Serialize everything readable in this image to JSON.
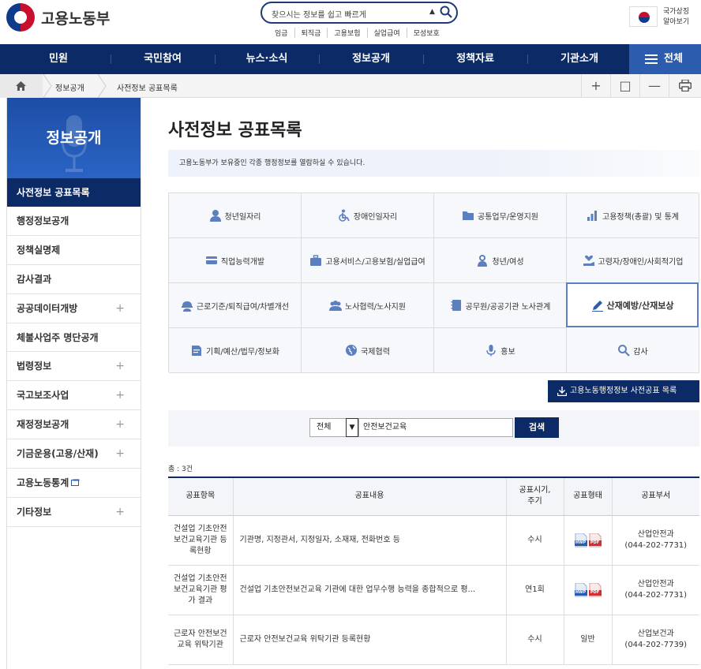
{
  "header": {
    "logo_text": "고용노동부",
    "search_placeholder": "찾으시는 정보를 쉽고 빠르게",
    "quick_links": [
      "임금",
      "퇴직금",
      "고용보험",
      "실업급여",
      "모성보호"
    ],
    "flag_text_1": "국가상징",
    "flag_text_2": "알아보기"
  },
  "gnb": {
    "items": [
      "민원",
      "국민참여",
      "뉴스·소식",
      "정보공개",
      "정책자료",
      "기관소개"
    ],
    "all_label": "전체"
  },
  "breadcrumb": {
    "items": [
      "정보공개",
      "사전정보 공표목록"
    ],
    "tools": [
      "+",
      "□",
      "—",
      "print"
    ]
  },
  "sidebar": {
    "title": "정보공개",
    "current": "사전정보 공표목록",
    "items": [
      {
        "label": "행정정보공개",
        "expand": false
      },
      {
        "label": "정책실명제",
        "expand": false
      },
      {
        "label": "감사결과",
        "expand": false
      },
      {
        "label": "공공데이터개방",
        "expand": true
      },
      {
        "label": "체불사업주 명단공개",
        "expand": false
      },
      {
        "label": "법령정보",
        "expand": true
      },
      {
        "label": "국고보조사업",
        "expand": true
      },
      {
        "label": "재정정보공개",
        "expand": true
      },
      {
        "label": "기금운용(고용/산재)",
        "expand": true
      },
      {
        "label": "고용노동통계",
        "expand": false
      },
      {
        "label": "기타정보",
        "expand": true
      }
    ]
  },
  "page": {
    "title": "사전정보 공표목록",
    "intro": "고용노동부가 보유중인 각종 행정정보를 열람하실 수 있습니다."
  },
  "categories": [
    {
      "label": "청년일자리",
      "icon": "person-icon"
    },
    {
      "label": "장애인일자리",
      "icon": "wheelchair-icon"
    },
    {
      "label": "공통업무/운영지원",
      "icon": "folder-icon"
    },
    {
      "label": "고용정책(총괄) 및 통계",
      "icon": "bar-chart-icon"
    },
    {
      "label": "직업능력개발",
      "icon": "card-icon"
    },
    {
      "label": "고용서비스/고용보험/실업급여",
      "icon": "briefcase-icon"
    },
    {
      "label": "청년/여성",
      "icon": "woman-icon"
    },
    {
      "label": "고령자/장애인/사회적기업",
      "icon": "hand-heart-icon"
    },
    {
      "label": "근로기준/퇴직급여/차별개선",
      "icon": "worker-icon"
    },
    {
      "label": "노사협력/노사지원",
      "icon": "group-icon"
    },
    {
      "label": "공무원/공공기관 노사관계",
      "icon": "notebook-icon"
    },
    {
      "label": "산재예방/산재보상",
      "icon": "pencil-icon",
      "active": true
    },
    {
      "label": "기획/예산/법무/정보화",
      "icon": "document-icon"
    },
    {
      "label": "국제협력",
      "icon": "globe-icon"
    },
    {
      "label": "홍보",
      "icon": "microphone-icon"
    },
    {
      "label": "감사",
      "icon": "magnifier-icon"
    }
  ],
  "download_button": "고용노동행정정보 사전공표 목록",
  "search": {
    "select": "전체",
    "keyword": "안전보건교육",
    "button": "검색"
  },
  "result_count": "총 : 3건",
  "table": {
    "headers": [
      "공표항목",
      "공표내용",
      "공표시기,\n주기",
      "공표형태",
      "공표부서"
    ],
    "rows": [
      {
        "item": "건설업 기초안전보건교육기관 등록현황",
        "content": "기관명, 지정관서, 지정일자, 소재재, 전화번호 등",
        "period": "수시",
        "form": "files",
        "dept": "산업안전과",
        "phone": "(044-202-7731)"
      },
      {
        "item": "건설업 기초안전보건교육기관 평가 결과",
        "content": "건설업 기초안전보건교육 기관에 대한 업무수행 능력을 종합적으로 평...",
        "period": "연1회",
        "form": "files",
        "dept": "산업안전과",
        "phone": "(044-202-7731)"
      },
      {
        "item": "근로자 안전보건교육 위탁기관",
        "content": "근로자 안전보건교육 위탁기관 등록현황",
        "period": "수시",
        "form": "일반",
        "dept": "산업보건과",
        "phone": "(044-202-7739)"
      }
    ]
  },
  "colors": {
    "navy": "#0c2a66",
    "blue": "#2b5cae",
    "active_border": "#5b7ec4"
  }
}
